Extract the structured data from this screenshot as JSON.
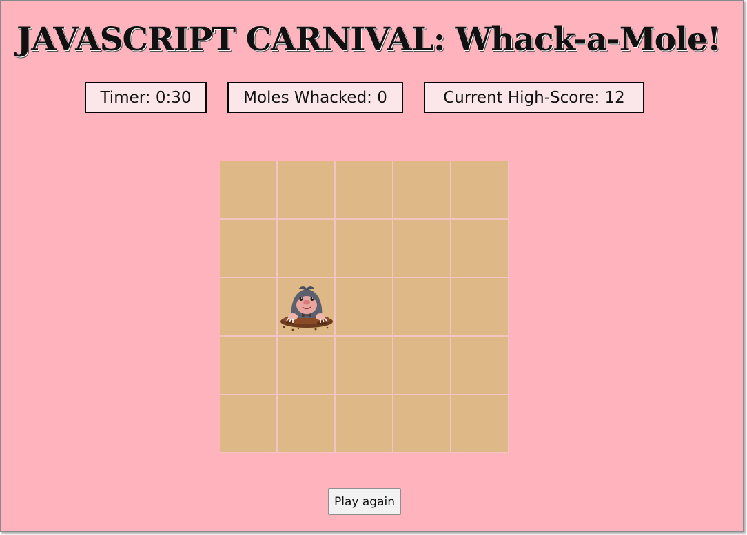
{
  "title": "JAVASCRIPT CARNIVAL: Whack-a-Mole!",
  "stats": {
    "timer": {
      "label": "Timer:",
      "value": "0:30"
    },
    "moles": {
      "label": "Moles Whacked:",
      "value": "0"
    },
    "high": {
      "label": "Current High-Score:",
      "value": "12"
    }
  },
  "board": {
    "rows": 5,
    "cols": 5,
    "mole_cell": {
      "row": 3,
      "col": 2
    },
    "cell_color": "#deb887",
    "background_color": "#ffb3bd"
  },
  "play_button": {
    "label": "Play again"
  }
}
